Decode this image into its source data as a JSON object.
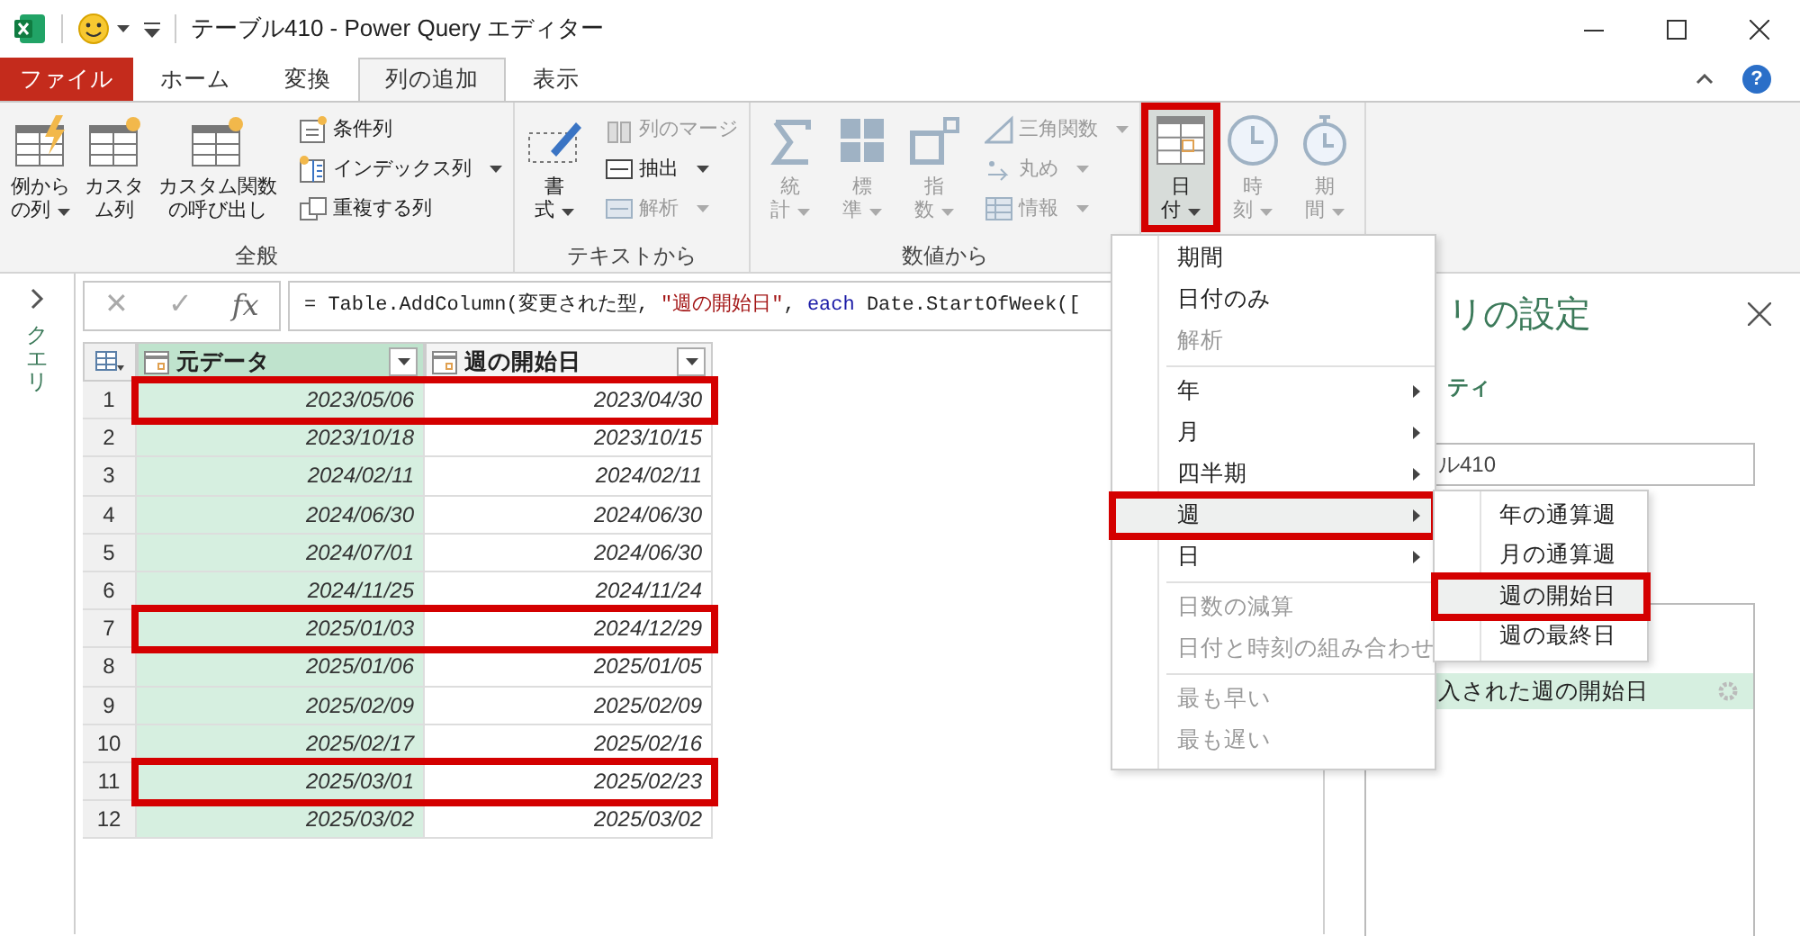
{
  "window": {
    "title": "テーブル410 - Power Query エディター"
  },
  "ribbon_tabs": [
    {
      "label": "ファイル",
      "kind": "file",
      "selected": false
    },
    {
      "label": "ホーム",
      "kind": "tab",
      "selected": false
    },
    {
      "label": "変換",
      "kind": "tab",
      "selected": false
    },
    {
      "label": "列の追加",
      "kind": "tab",
      "selected": true
    },
    {
      "label": "表示",
      "kind": "tab",
      "selected": false
    }
  ],
  "help": "?",
  "ribbon_groups": [
    {
      "label": "全般",
      "large": [
        {
          "kind": "example",
          "lines": [
            "例から",
            "の列"
          ],
          "dropdown": true,
          "disabled": false,
          "annotated": false
        },
        {
          "kind": "custom",
          "lines": [
            "カスタ",
            "ム列"
          ],
          "dropdown": false,
          "disabled": false,
          "annotated": false
        },
        {
          "kind": "function",
          "lines": [
            "カスタム関数",
            "の呼び出し"
          ],
          "dropdown": false,
          "disabled": false,
          "annotated": false
        }
      ],
      "small": [
        {
          "kind": "conditional",
          "label": "条件列",
          "dropdown": false,
          "disabled": false
        },
        {
          "kind": "index",
          "label": "インデックス列",
          "dropdown": true,
          "disabled": false
        },
        {
          "kind": "duplicate",
          "label": "重複する列",
          "dropdown": false,
          "disabled": false
        }
      ]
    },
    {
      "label": "テキストから",
      "large": [
        {
          "kind": "format",
          "lines": [
            "書",
            "式"
          ],
          "dropdown": true,
          "disabled": false,
          "annotated": false
        }
      ],
      "small": [
        {
          "kind": "merge",
          "label": "列のマージ",
          "dropdown": false,
          "disabled": true
        },
        {
          "kind": "extract",
          "label": "抽出",
          "dropdown": true,
          "disabled": false
        },
        {
          "kind": "parse",
          "label": "解析",
          "dropdown": true,
          "disabled": true
        }
      ]
    },
    {
      "label": "数値から",
      "large": [
        {
          "kind": "statistics",
          "lines": [
            "統",
            "計"
          ],
          "dropdown": true,
          "disabled": true,
          "annotated": false
        },
        {
          "kind": "standard",
          "lines": [
            "標",
            "準"
          ],
          "dropdown": true,
          "disabled": true,
          "annotated": false
        },
        {
          "kind": "exponent",
          "lines": [
            "指",
            "数"
          ],
          "dropdown": true,
          "disabled": true,
          "annotated": false
        }
      ],
      "small": [
        {
          "kind": "trig",
          "label": "三角関数",
          "dropdown": true,
          "disabled": true
        },
        {
          "kind": "round",
          "label": "丸め",
          "dropdown": true,
          "disabled": true
        },
        {
          "kind": "info",
          "label": "情報",
          "dropdown": true,
          "disabled": true
        }
      ]
    },
    {
      "large": [
        {
          "kind": "date",
          "lines": [
            "日",
            "付"
          ],
          "dropdown": true,
          "disabled": false,
          "annotated": true
        },
        {
          "kind": "time",
          "lines": [
            "時",
            "刻"
          ],
          "dropdown": true,
          "disabled": true,
          "annotated": false
        },
        {
          "kind": "duration",
          "lines": [
            "期",
            "間"
          ],
          "dropdown": true,
          "disabled": true,
          "annotated": false
        }
      ]
    }
  ],
  "queries_pane": {
    "label": "クエリ"
  },
  "formula_bar": {
    "cancel": "✕",
    "confirm": "✓",
    "fx": "fx",
    "tokens": [
      {
        "kind": "plain",
        "text": "= Table.AddColumn(変更された型, "
      },
      {
        "kind": "string",
        "text": "\"週の開始日\""
      },
      {
        "kind": "plain",
        "text": ", "
      },
      {
        "kind": "keyword",
        "text": "each"
      },
      {
        "kind": "plain",
        "text": " Date.StartOfWeek(["
      }
    ]
  },
  "table": {
    "columns": [
      {
        "name": "元データ",
        "selected": true
      },
      {
        "name": "週の開始日",
        "selected": false
      }
    ],
    "rows": [
      {
        "number": "1",
        "cells": [
          "2023/05/06",
          "2023/04/30"
        ],
        "highlighted": true
      },
      {
        "number": "2",
        "cells": [
          "2023/10/18",
          "2023/10/15"
        ],
        "highlighted": false
      },
      {
        "number": "3",
        "cells": [
          "2024/02/11",
          "2024/02/11"
        ],
        "highlighted": false
      },
      {
        "number": "4",
        "cells": [
          "2024/06/30",
          "2024/06/30"
        ],
        "highlighted": false
      },
      {
        "number": "5",
        "cells": [
          "2024/07/01",
          "2024/06/30"
        ],
        "highlighted": false
      },
      {
        "number": "6",
        "cells": [
          "2024/11/25",
          "2024/11/24"
        ],
        "highlighted": false
      },
      {
        "number": "7",
        "cells": [
          "2025/01/03",
          "2024/12/29"
        ],
        "highlighted": true
      },
      {
        "number": "8",
        "cells": [
          "2025/01/06",
          "2025/01/05"
        ],
        "highlighted": false
      },
      {
        "number": "9",
        "cells": [
          "2025/02/09",
          "2025/02/09"
        ],
        "highlighted": false
      },
      {
        "number": "10",
        "cells": [
          "2025/02/17",
          "2025/02/16"
        ],
        "highlighted": false
      },
      {
        "number": "11",
        "cells": [
          "2025/03/01",
          "2025/02/23"
        ],
        "highlighted": true
      },
      {
        "number": "12",
        "cells": [
          "2025/03/02",
          "2025/03/02"
        ],
        "highlighted": false
      }
    ]
  },
  "settings_pane": {
    "title": "リの設定",
    "section": "ティ",
    "name_value": "ル410",
    "steps": [
      {
        "label": "入された週の開始日",
        "selected": true
      }
    ]
  },
  "date_menu": {
    "sections": [
      [
        {
          "label": "期間",
          "disabled": false,
          "submenu": false,
          "highlighted": false,
          "annotated": false
        },
        {
          "label": "日付のみ",
          "disabled": false,
          "submenu": false,
          "highlighted": false,
          "annotated": false
        },
        {
          "label": "解析",
          "disabled": true,
          "submenu": false,
          "highlighted": false,
          "annotated": false
        }
      ],
      [
        {
          "label": "年",
          "disabled": false,
          "submenu": true,
          "highlighted": false,
          "annotated": false
        },
        {
          "label": "月",
          "disabled": false,
          "submenu": true,
          "highlighted": false,
          "annotated": false
        },
        {
          "label": "四半期",
          "disabled": false,
          "submenu": true,
          "highlighted": false,
          "annotated": false
        },
        {
          "label": "週",
          "disabled": false,
          "submenu": true,
          "highlighted": true,
          "annotated": true
        },
        {
          "label": "日",
          "disabled": false,
          "submenu": true,
          "highlighted": false,
          "annotated": false
        }
      ],
      [
        {
          "label": "日数の減算",
          "disabled": true,
          "submenu": false,
          "highlighted": false,
          "annotated": false
        },
        {
          "label": "日付と時刻の組み合わせ",
          "disabled": true,
          "submenu": false,
          "highlighted": false,
          "annotated": false
        }
      ],
      [
        {
          "label": "最も早い",
          "disabled": true,
          "submenu": false,
          "highlighted": false,
          "annotated": false
        },
        {
          "label": "最も遅い",
          "disabled": true,
          "submenu": false,
          "highlighted": false,
          "annotated": false
        }
      ]
    ]
  },
  "week_submenu": {
    "items": [
      {
        "label": "年の通算週",
        "highlighted": false,
        "annotated": false
      },
      {
        "label": "月の通算週",
        "highlighted": false,
        "annotated": false
      },
      {
        "label": "週の開始日",
        "highlighted": true,
        "annotated": true
      },
      {
        "label": "週の最終日",
        "highlighted": false,
        "annotated": false
      }
    ]
  }
}
